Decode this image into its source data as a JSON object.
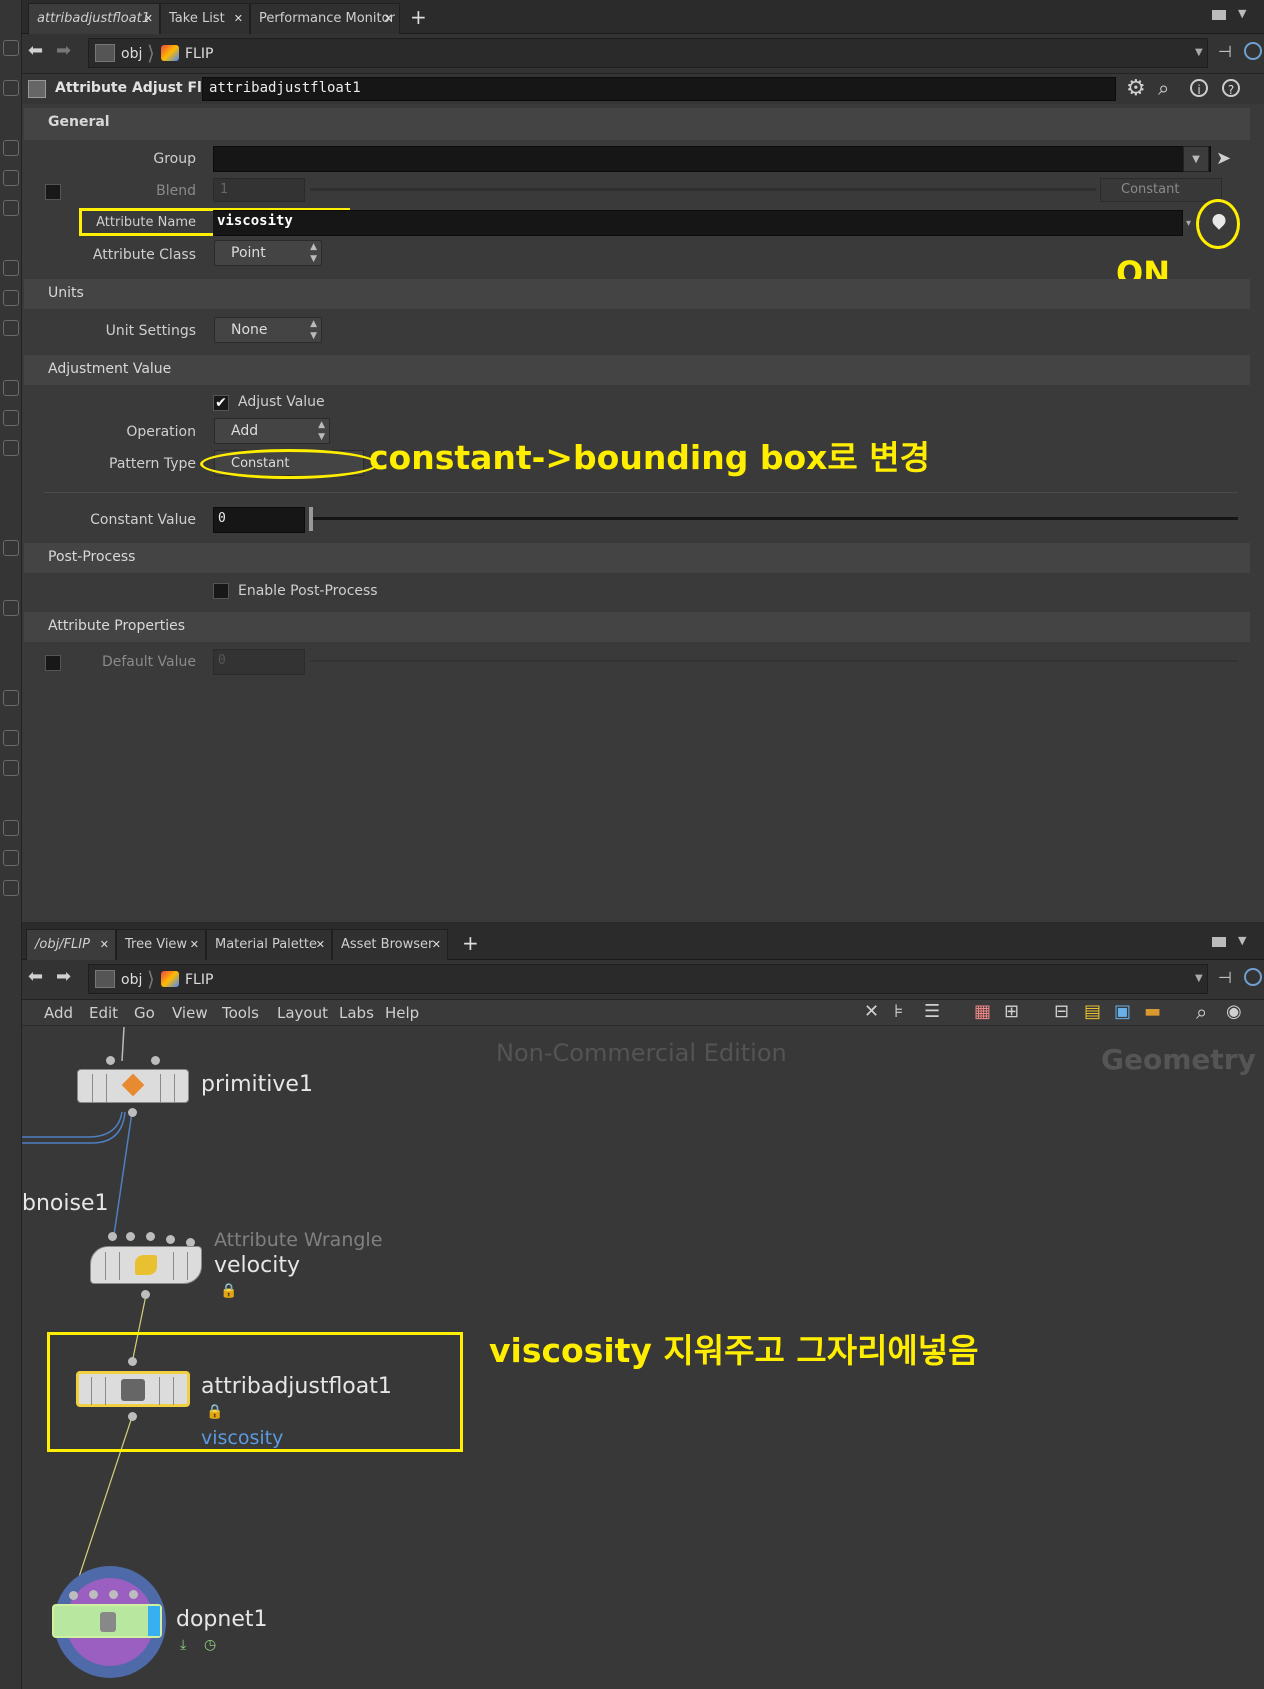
{
  "param_pane": {
    "tabs": [
      {
        "label": "attribadjustfloat1"
      },
      {
        "label": "Take List"
      },
      {
        "label": "Performance Monitor"
      }
    ],
    "path": {
      "obj": "obj",
      "flip": "FLIP"
    },
    "node_type": "Attribute Adjust Float",
    "node_name": "attribadjustfloat1",
    "sections": {
      "general": "General",
      "units": "Units",
      "adjustment": "Adjustment Value",
      "post": "Post-Process",
      "attr_props": "Attribute Properties"
    },
    "fields": {
      "group_label": "Group",
      "group_value": "",
      "blend_label": "Blend",
      "blend_value": "1",
      "blend_mode": "Constant",
      "attr_name_label": "Attribute Name",
      "attr_name_value": "viscosity",
      "attr_class_label": "Attribute Class",
      "attr_class_value": "Point",
      "unit_label": "Unit Settings",
      "unit_value": "None",
      "adjust_value_label": "Adjust Value",
      "adjust_value_checked": true,
      "operation_label": "Operation",
      "operation_value": "Add",
      "pattern_label": "Pattern Type",
      "pattern_value": "Constant",
      "constant_label": "Constant Value",
      "constant_value": "0",
      "post_label": "Enable Post-Process",
      "default_label": "Default Value",
      "default_value": "0"
    },
    "annotations": {
      "on": "ON",
      "pattern_note": "constant->bounding box로 변경"
    }
  },
  "network_pane": {
    "tabs": [
      {
        "label": "/obj/FLIP"
      },
      {
        "label": "Tree View"
      },
      {
        "label": "Material Palette"
      },
      {
        "label": "Asset Browser"
      }
    ],
    "path": {
      "obj": "obj",
      "flip": "FLIP"
    },
    "menu": [
      "Add",
      "Edit",
      "Go",
      "View",
      "Tools",
      "Layout",
      "Labs",
      "Help"
    ],
    "watermark": "Non-Commercial Edition",
    "context_label": "Geometry",
    "nodes": {
      "primitive": "primitive1",
      "bnoise": "bnoise1",
      "wrangle_type": "Attribute Wrangle",
      "wrangle_name": "velocity",
      "adjust_name": "attribadjustfloat1",
      "adjust_comment": "viscosity",
      "dopnet": "dopnet1"
    },
    "annotation": "viscosity 지워주고 그자리에넣음"
  },
  "colors": {
    "highlight": "#ffee00",
    "wire_blue": "#4f7fbf",
    "comment_blue": "#5b9ae0"
  }
}
